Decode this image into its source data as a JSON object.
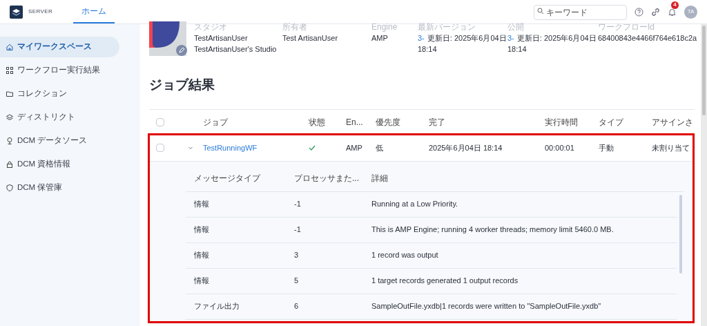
{
  "header": {
    "logo_text": "SERVER",
    "tabs": [
      {
        "label": "ホーム",
        "selected": true
      }
    ],
    "search": {
      "placeholder": "キーワード"
    },
    "notifications": {
      "count": "4"
    },
    "avatar": {
      "initials": "TA"
    }
  },
  "sidebar": {
    "items": [
      {
        "label": "マイワークスペース",
        "selected": true
      },
      {
        "label": "ワークフロー実行結果",
        "selected": false
      },
      {
        "label": "コレクション",
        "selected": false
      },
      {
        "label": "ディストリクト",
        "selected": false
      },
      {
        "label": "DCM データソース",
        "selected": false
      },
      {
        "label": "DCM 資格情報",
        "selected": false
      },
      {
        "label": "DCM 保管庫",
        "selected": false
      }
    ]
  },
  "workflow_info": {
    "fields": [
      {
        "label": "スタジオ",
        "lines": [
          {
            "text": "TestArtisanUser"
          },
          {
            "text": "TestArtisanUser's Studio"
          }
        ]
      },
      {
        "label": "所有者",
        "lines": [
          {
            "text": "Test ArtisanUser"
          }
        ]
      },
      {
        "label": "Engine",
        "lines": [
          {
            "text": "AMP"
          }
        ]
      },
      {
        "label": "最新バージョン",
        "lines": [
          {
            "version": "3-",
            "text": "更新日: 2025年6月04日"
          },
          {
            "text": "18:14"
          }
        ]
      },
      {
        "label": "公開",
        "lines": [
          {
            "version": "3-",
            "text": "更新日: 2025年6月04日"
          },
          {
            "text": "18:14"
          }
        ]
      },
      {
        "label": "ワークフローId",
        "lines": [
          {
            "text": "68400843e4466f764e618c2a"
          }
        ]
      }
    ]
  },
  "jobs": {
    "title": "ジョブ結果",
    "select_all_checked": false,
    "columns": [
      "ジョブ",
      "状態",
      "En...",
      "優先度",
      "完了",
      "実行時間",
      "タイプ",
      "アサインさ"
    ],
    "rows": [
      {
        "checked": false,
        "expanded": true,
        "job": "TestRunningWF",
        "succeeded": true,
        "engine": "AMP",
        "priority": "低",
        "completed": "2025年6月04日 18:14",
        "duration": "00:00:01",
        "type": "手動",
        "assignment": "未割り当て",
        "messages": {
          "columns": [
            "メッセージタイプ",
            "プロセッサまた...",
            "詳細"
          ],
          "rows": [
            {
              "type": "情報",
              "processor": "-1",
              "detail": "Running at a Low Priority."
            },
            {
              "type": "情報",
              "processor": "-1",
              "detail": "This is AMP Engine; running 4 worker threads; memory limit 5460.0 MB."
            },
            {
              "type": "情報",
              "processor": "3",
              "detail": "1 record was output"
            },
            {
              "type": "情報",
              "processor": "5",
              "detail": "1 target records generated 1 output records"
            },
            {
              "type": "ファイル出力",
              "processor": "6",
              "detail": "SampleOutFile.yxdb|1 records were written to \"SampleOutFile.yxdb\""
            }
          ]
        }
      }
    ]
  }
}
